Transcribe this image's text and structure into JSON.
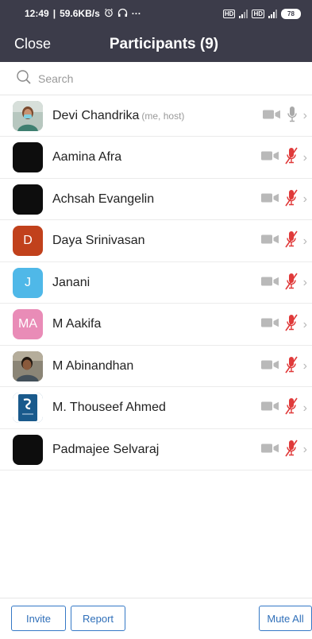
{
  "status_bar": {
    "time": "12:49",
    "speed": "59.6KB/s",
    "more": "···",
    "battery": "78"
  },
  "header": {
    "close_label": "Close",
    "title": "Participants (9)"
  },
  "search": {
    "placeholder": "Search"
  },
  "participants": [
    {
      "name": "Devi Chandrika",
      "tag": "(me, host)",
      "avatar_type": "photo",
      "avatar_color": "#9bb0a5",
      "mic": "unmuted"
    },
    {
      "name": "Aamina Afra",
      "tag": "",
      "avatar_type": "dark",
      "avatar_color": "#0d0d0d",
      "mic": "muted"
    },
    {
      "name": "Achsah Evangelin",
      "tag": "",
      "avatar_type": "dark",
      "avatar_color": "#0d0d0d",
      "mic": "muted"
    },
    {
      "name": "Daya Srinivasan",
      "tag": "",
      "avatar_type": "letter",
      "avatar_letter": "D",
      "avatar_color": "#c1411c",
      "mic": "muted"
    },
    {
      "name": "Janani",
      "tag": "",
      "avatar_type": "letter",
      "avatar_letter": "J",
      "avatar_color": "#4fb8e8",
      "mic": "muted"
    },
    {
      "name": "M Aakifa",
      "tag": "",
      "avatar_type": "letter",
      "avatar_letter": "MA",
      "avatar_color": "#e98cb7",
      "mic": "muted"
    },
    {
      "name": "M Abinandhan",
      "tag": "",
      "avatar_type": "photo",
      "avatar_color": "#7a6a58",
      "mic": "muted"
    },
    {
      "name": "M. Thouseef Ahmed",
      "tag": "",
      "avatar_type": "logo",
      "avatar_color": "#1a5a8c",
      "mic": "muted"
    },
    {
      "name": "Padmajee Selvaraj",
      "tag": "",
      "avatar_type": "dark",
      "avatar_color": "#0d0d0d",
      "mic": "muted"
    }
  ],
  "footer": {
    "invite_label": "Invite",
    "report_label": "Report",
    "mute_all_label": "Mute All"
  },
  "colors": {
    "header_bg": "#3c3c4a",
    "muted_mic": "#e03a3a",
    "button_blue": "#2f6fb9"
  }
}
